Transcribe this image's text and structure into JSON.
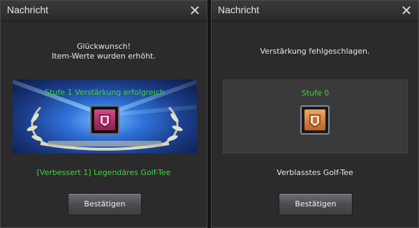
{
  "left_dialog": {
    "title": "Nachricht",
    "close_symbol": "✕",
    "message_line1": "Glückwunsch!",
    "message_line2": "Item-Werte wurden erhöht.",
    "stage_text": "Stufe 1 Verstärkung erfolgreich",
    "item_icon": "scroll-tee-icon",
    "item_name": "[Verbessert 1] Legendäres Golf-Tee",
    "item_name_color": "#3fd33f",
    "confirm_label": "Bestätigen"
  },
  "right_dialog": {
    "title": "Nachricht",
    "close_symbol": "✕",
    "message": "Verstärkung fehlgeschlagen.",
    "stage_text": "Stufe 0",
    "item_icon": "scroll-tee-icon",
    "item_name": "Verblasstes Golf-Tee",
    "item_name_color": "#e6e6e6",
    "confirm_label": "Bestätigen"
  },
  "colors": {
    "success_green": "#3fd33f",
    "dialog_bg": "#2b2b2b",
    "banner_blue": "#2f72d8"
  }
}
